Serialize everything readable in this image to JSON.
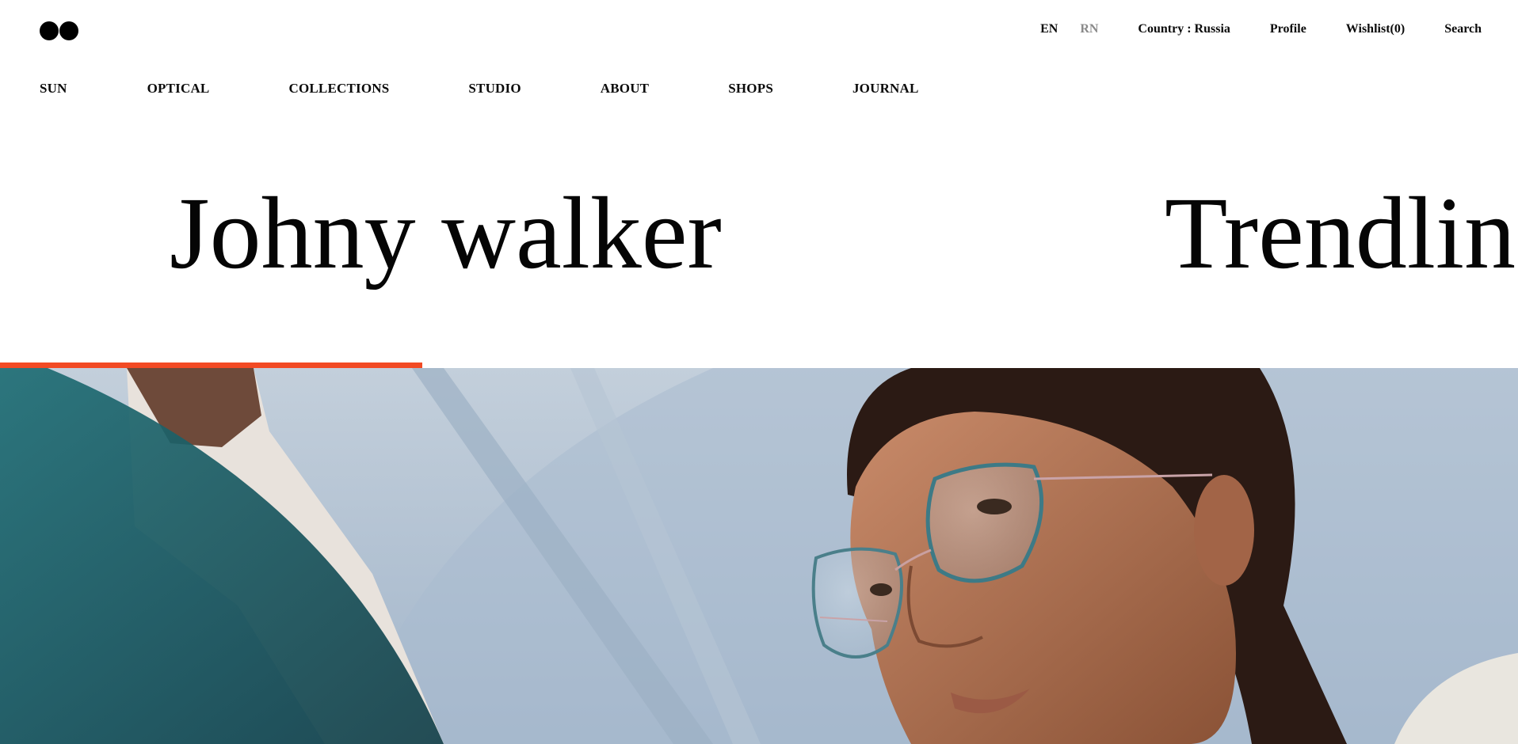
{
  "header": {
    "logo_name": "brand-logo",
    "utility": {
      "lang_en": "EN",
      "lang_rn": "RN",
      "country": "Country : Russia",
      "profile": "Profile",
      "wishlist": "Wishlist(0)",
      "search": "Search"
    },
    "nav": [
      {
        "label": "SUN"
      },
      {
        "label": "OPTICAL"
      },
      {
        "label": "COLLECTIONS"
      },
      {
        "label": "STUDIO"
      },
      {
        "label": "ABOUT"
      },
      {
        "label": "SHOPS"
      },
      {
        "label": "JOURNAL"
      }
    ]
  },
  "slider": {
    "titles": [
      "Johny walker",
      "Trendlin"
    ],
    "progress": 0.278,
    "accent_color": "#f24a24"
  },
  "hero": {
    "image": "woman-wearing-eyeglasses-photo"
  }
}
